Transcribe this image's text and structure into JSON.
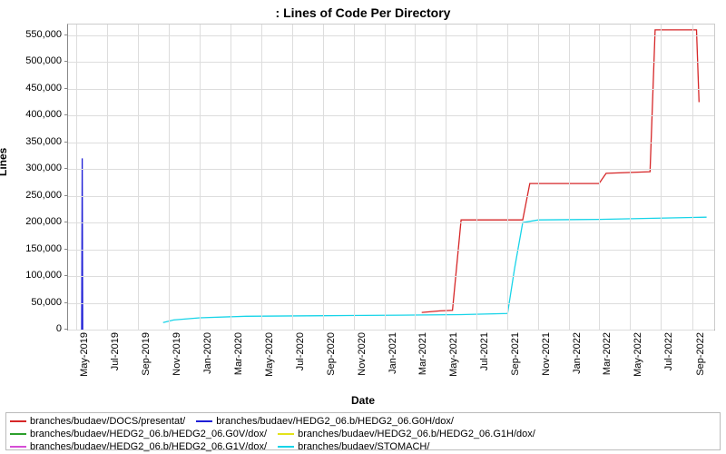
{
  "chart_data": {
    "type": "line",
    "title": " : Lines of Code Per Directory",
    "xlabel": "Date",
    "ylabel": "Lines",
    "ylim": [
      0,
      570000
    ],
    "y_ticks": [
      0,
      50000,
      100000,
      150000,
      200000,
      250000,
      300000,
      350000,
      400000,
      450000,
      500000,
      550000
    ],
    "y_tick_labels": [
      "0",
      "50,000",
      "100,000",
      "150,000",
      "200,000",
      "250,000",
      "300,000",
      "350,000",
      "400,000",
      "450,000",
      "500,000",
      "550,000"
    ],
    "x_ticks": [
      "May-2019",
      "Jul-2019",
      "Sep-2019",
      "Nov-2019",
      "Jan-2020",
      "Mar-2020",
      "May-2020",
      "Jul-2020",
      "Sep-2020",
      "Nov-2020",
      "Jan-2021",
      "Mar-2021",
      "May-2021",
      "Jul-2021",
      "Sep-2021",
      "Nov-2021",
      "Jan-2022",
      "Mar-2022",
      "May-2022",
      "Jul-2022",
      "Sep-2022"
    ],
    "xlim": [
      "2019-04-15",
      "2022-10-15"
    ],
    "series": [
      {
        "name": "branches/budaev/DOCS/presentat/",
        "color": "#d62728",
        "points": [
          [
            "2021-03-15",
            32000
          ],
          [
            "2021-04-20",
            35000
          ],
          [
            "2021-05-15",
            36000
          ],
          [
            "2021-06-01",
            205000
          ],
          [
            "2021-10-01",
            205000
          ],
          [
            "2021-10-15",
            273000
          ],
          [
            "2022-03-01",
            273000
          ],
          [
            "2022-03-15",
            292000
          ],
          [
            "2022-06-10",
            295000
          ],
          [
            "2022-06-20",
            560000
          ],
          [
            "2022-09-10",
            560000
          ],
          [
            "2022-09-15",
            425000
          ]
        ]
      },
      {
        "name": "branches/budaev/HEDG2_06.b/HEDG2_06.G0H/dox/",
        "color": "#1f1fd6",
        "points": [
          [
            "2019-05-12",
            0
          ],
          [
            "2019-05-13",
            320000
          ],
          [
            "2019-05-14",
            0
          ]
        ]
      },
      {
        "name": "branches/budaev/HEDG2_06.b/HEDG2_06.G0V/dox/",
        "color": "#2ca02c",
        "points": []
      },
      {
        "name": "branches/budaev/HEDG2_06.b/HEDG2_06.G1H/dox/",
        "color": "#e3e31a",
        "points": []
      },
      {
        "name": "branches/budaev/HEDG2_06.b/HEDG2_06.G1V/dox/",
        "color": "#d64ed6",
        "points": []
      },
      {
        "name": "branches/budaev/STOMACH/",
        "color": "#17d4e8",
        "points": [
          [
            "2019-10-20",
            13000
          ],
          [
            "2019-11-10",
            18000
          ],
          [
            "2020-01-01",
            22000
          ],
          [
            "2020-04-01",
            25000
          ],
          [
            "2020-09-01",
            26000
          ],
          [
            "2021-02-01",
            27000
          ],
          [
            "2021-06-01",
            28000
          ],
          [
            "2021-09-01",
            30000
          ],
          [
            "2021-09-15",
            115000
          ],
          [
            "2021-10-01",
            200000
          ],
          [
            "2021-11-01",
            205000
          ],
          [
            "2022-03-01",
            206000
          ],
          [
            "2022-09-30",
            210000
          ]
        ]
      }
    ]
  }
}
